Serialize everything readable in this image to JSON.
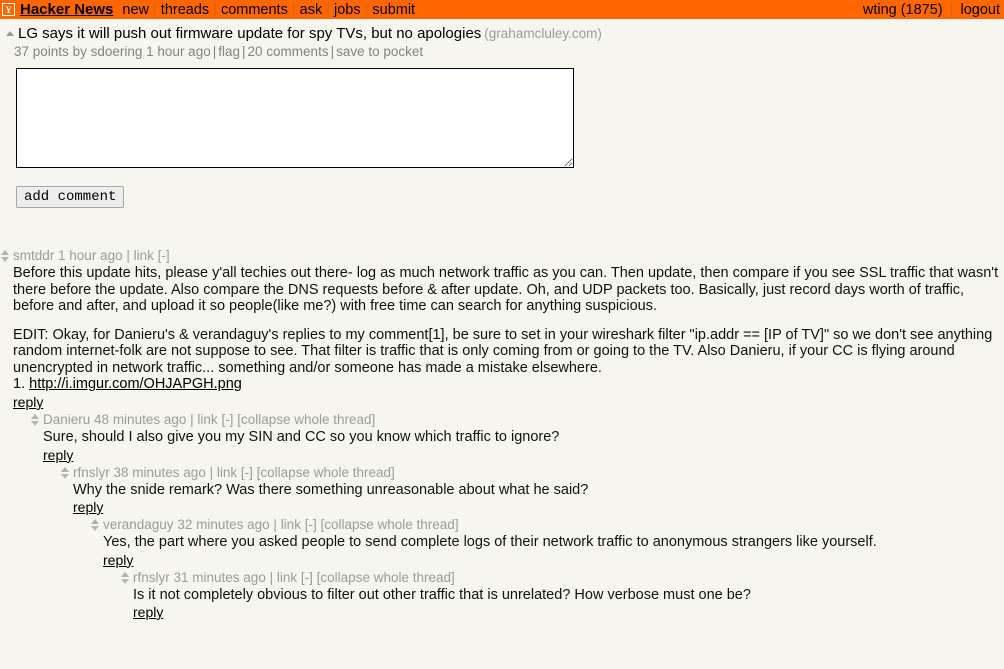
{
  "header": {
    "logo": "Y",
    "logo_icon": "hn-logo-icon",
    "site_title": "Hacker News",
    "nav": [
      {
        "label": "new"
      },
      {
        "label": "threads"
      },
      {
        "label": "comments"
      },
      {
        "label": "ask"
      },
      {
        "label": "jobs"
      },
      {
        "label": "submit"
      }
    ],
    "separator": "|",
    "user": "wting (1875)",
    "logout": "logout",
    "bg_color": "#ff6600"
  },
  "story": {
    "upvote_icon": "upvote-triangle-icon",
    "title": "LG says it will push out firmware update for spy TVs, but no apologies",
    "domain": "(grahamcluley.com)",
    "points": "37 points",
    "by": "by",
    "author": "sdoering",
    "time": "1 hour ago",
    "flag": "flag",
    "comments": "20 comments",
    "save": "save to pocket",
    "separator": "|"
  },
  "comment_form": {
    "textarea_value": "",
    "textarea_placeholder": "",
    "submit_label": "add comment"
  },
  "comments": [
    {
      "level": 0,
      "author": "smtddr",
      "time": "1 hour ago",
      "link": "link",
      "toggle": "[-]",
      "collapse": "",
      "paragraphs": [
        "Before this update hits, please y'all techies out there- log as much network traffic as you can. Then update, then compare if you see SSL traffic that wasn't there before the update. Also compare the DNS requests before & after update. Oh, and UDP packets too. Basically, just record days worth of traffic, before and after, and upload it so people(like me?) with free time can search for anything suspicious.",
        "EDIT: Okay, for Danieru's & verandaguy's replies to my comment[1], be sure to set in your wireshark filter \"ip.addr == [IP of TV]\" so we don't see anything random internet-folk are not suppose to see. That filter is traffic that is only coming from or going to the TV. Also Danieru, if your CC is flying around unencrypted in network traffic... something and/or someone has made a mistake elsewhere."
      ],
      "footnote_number": "1.",
      "footnote_url": "http://i.imgur.com/OHJAPGH.png",
      "reply": "reply"
    },
    {
      "level": 1,
      "author": "Danieru",
      "time": "48 minutes ago",
      "link": "link",
      "toggle": "[-]",
      "collapse": "[collapse whole thread]",
      "paragraphs": [
        "Sure, should I also give you my SIN and CC so you know which traffic to ignore?"
      ],
      "reply": "reply"
    },
    {
      "level": 2,
      "author": "rfnslyr",
      "time": "38 minutes ago",
      "link": "link",
      "toggle": "[-]",
      "collapse": "[collapse whole thread]",
      "paragraphs": [
        "Why the snide remark? Was there something unreasonable about what he said?"
      ],
      "reply": "reply"
    },
    {
      "level": 3,
      "author": "verandaguy",
      "time": "32 minutes ago",
      "link": "link",
      "toggle": "[-]",
      "collapse": "[collapse whole thread]",
      "paragraphs": [
        "Yes, the part where you asked people to send complete logs of their network traffic to anonymous strangers like yourself."
      ],
      "reply": "reply"
    },
    {
      "level": 4,
      "author": "rfnslyr",
      "time": "31 minutes ago",
      "link": "link",
      "toggle": "[-]",
      "collapse": "[collapse whole thread]",
      "paragraphs": [
        "Is it not completely obvious to filter out other traffic that is unrelated? How verbose must one be?"
      ],
      "reply": "reply"
    }
  ]
}
